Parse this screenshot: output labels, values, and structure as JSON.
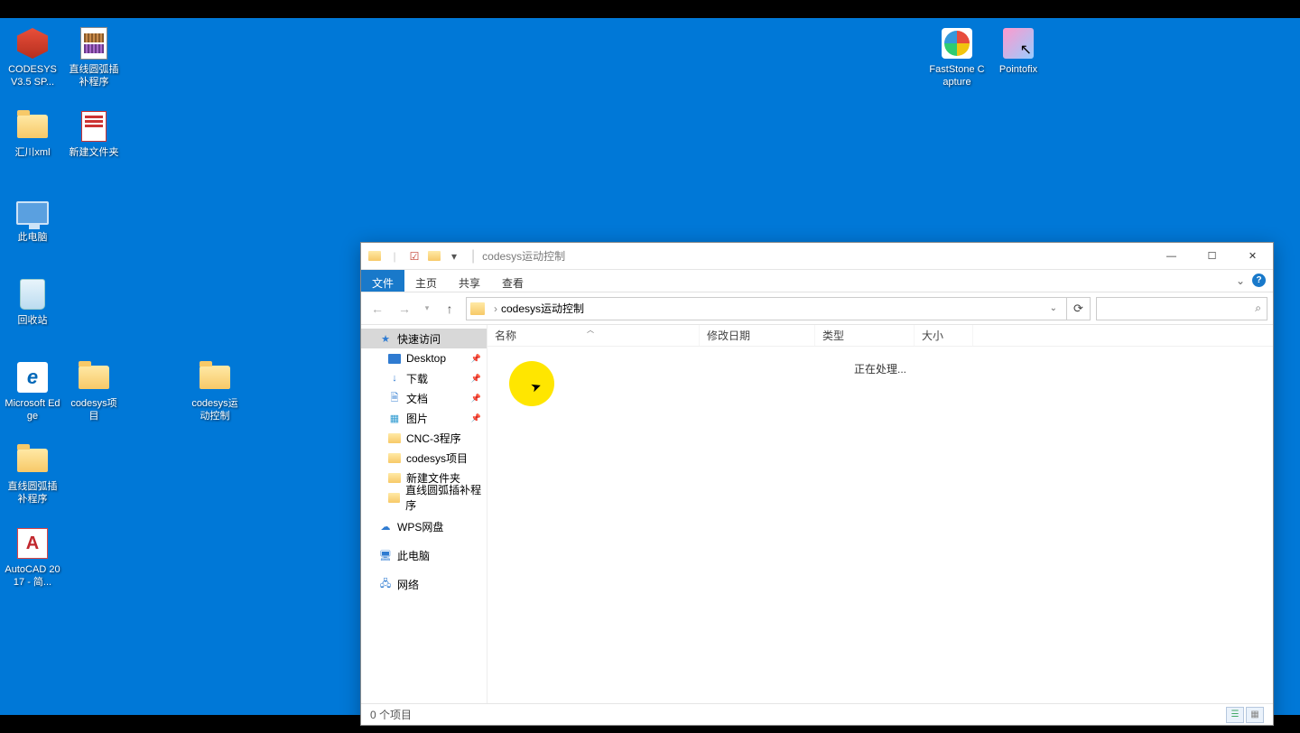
{
  "desktop_icons": {
    "codesys_sp": "CODESYS V3.5 SP...",
    "arc_prog": "直线圆弧插补程序",
    "huichuan": "汇川xml",
    "new_folder": "新建文件夹",
    "this_pc": "此电脑",
    "recycle": "回收站",
    "edge": "Microsoft Edge",
    "codesys_proj": "codesys项目",
    "codesys_motion": "codesys运动控制",
    "arc_prog2": "直线圆弧插补程序",
    "autocad": "AutoCAD 2017 - 简...",
    "faststone": "FastStone Capture",
    "pointofix": "Pointofix",
    "edge_letter": "e",
    "acad_letter": "A"
  },
  "explorer": {
    "title_sep": "|",
    "title": "codesys运动控制",
    "tabs": {
      "file": "文件",
      "home": "主页",
      "share": "共享",
      "view": "查看"
    },
    "addr_sep": "›",
    "addr": "codesys运动控制",
    "nav": {
      "quick": "快速访问",
      "desktop": "Desktop",
      "downloads": "下载",
      "documents": "文档",
      "pictures": "图片",
      "cnc": "CNC-3程序",
      "codesys_proj": "codesys项目",
      "new_folder": "新建文件夹",
      "arc": "直线圆弧插补程序",
      "wps": "WPS网盘",
      "this_pc": "此电脑",
      "network": "网络"
    },
    "cols": {
      "name": "名称",
      "date": "修改日期",
      "type": "类型",
      "size": "大小"
    },
    "processing": "正在处理...",
    "status": "0 个项目"
  }
}
